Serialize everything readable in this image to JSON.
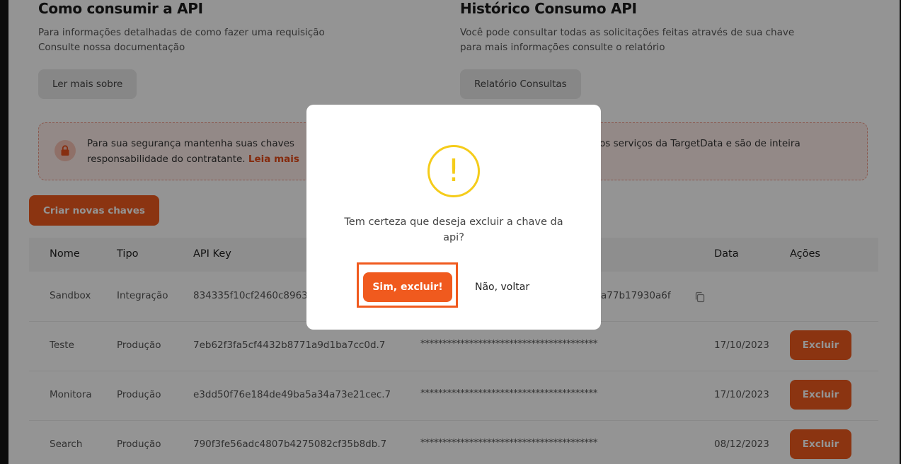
{
  "api_section": {
    "title": "Como consumir a API",
    "desc_line1": "Para informações detalhadas de como fazer uma requisição",
    "desc_line2": "Consulte nossa documentação",
    "button": "Ler mais sobre"
  },
  "history_section": {
    "title": "Histórico Consumo API",
    "desc_line1": "Você pode consultar todas as solicitações feitas através de sua chave",
    "desc_line2": "para mais informações consulte o relatório",
    "button": "Relatório Consultas"
  },
  "alert": {
    "text_left": "Para sua segurança mantenha suas chaves",
    "text_right": "os serviços da TargetData e são de inteira",
    "line2": "responsabilidade do contratante.",
    "link": "Leia mais"
  },
  "create_button": "Criar novas chaves",
  "table": {
    "headers": {
      "name": "Nome",
      "type": "Tipo",
      "api_key": "API Key",
      "date": "Data",
      "actions": "Ações"
    },
    "action_label": "Excluir",
    "rows": [
      {
        "name": "Sandbox",
        "type": "Integração",
        "key": "834335f10cf2460c8963",
        "secret": "a77b17930a6f",
        "date": ""
      },
      {
        "name": "Teste",
        "type": "Produção",
        "key": "7eb62f3fa5cf4432b8771a9d1ba7cc0d.7",
        "secret": "****************************************",
        "date": "17/10/2023"
      },
      {
        "name": "Monitora",
        "type": "Produção",
        "key": "e3dd50f76e184de49ba5a34a73e21cec.7",
        "secret": "****************************************",
        "date": "17/10/2023"
      },
      {
        "name": "Search",
        "type": "Produção",
        "key": "790f3fe56adc4807b4275082cf35b8db.7",
        "secret": "****************************************",
        "date": "08/12/2023"
      }
    ]
  },
  "modal": {
    "icon": "!",
    "message": "Tem certeza que deseja excluir a chave da api?",
    "confirm": "Sim, excluir!",
    "cancel": "Não, voltar"
  },
  "colors": {
    "accent": "#f05a1e",
    "warning": "#f5cc1a",
    "alert_bg": "#fdece8"
  }
}
